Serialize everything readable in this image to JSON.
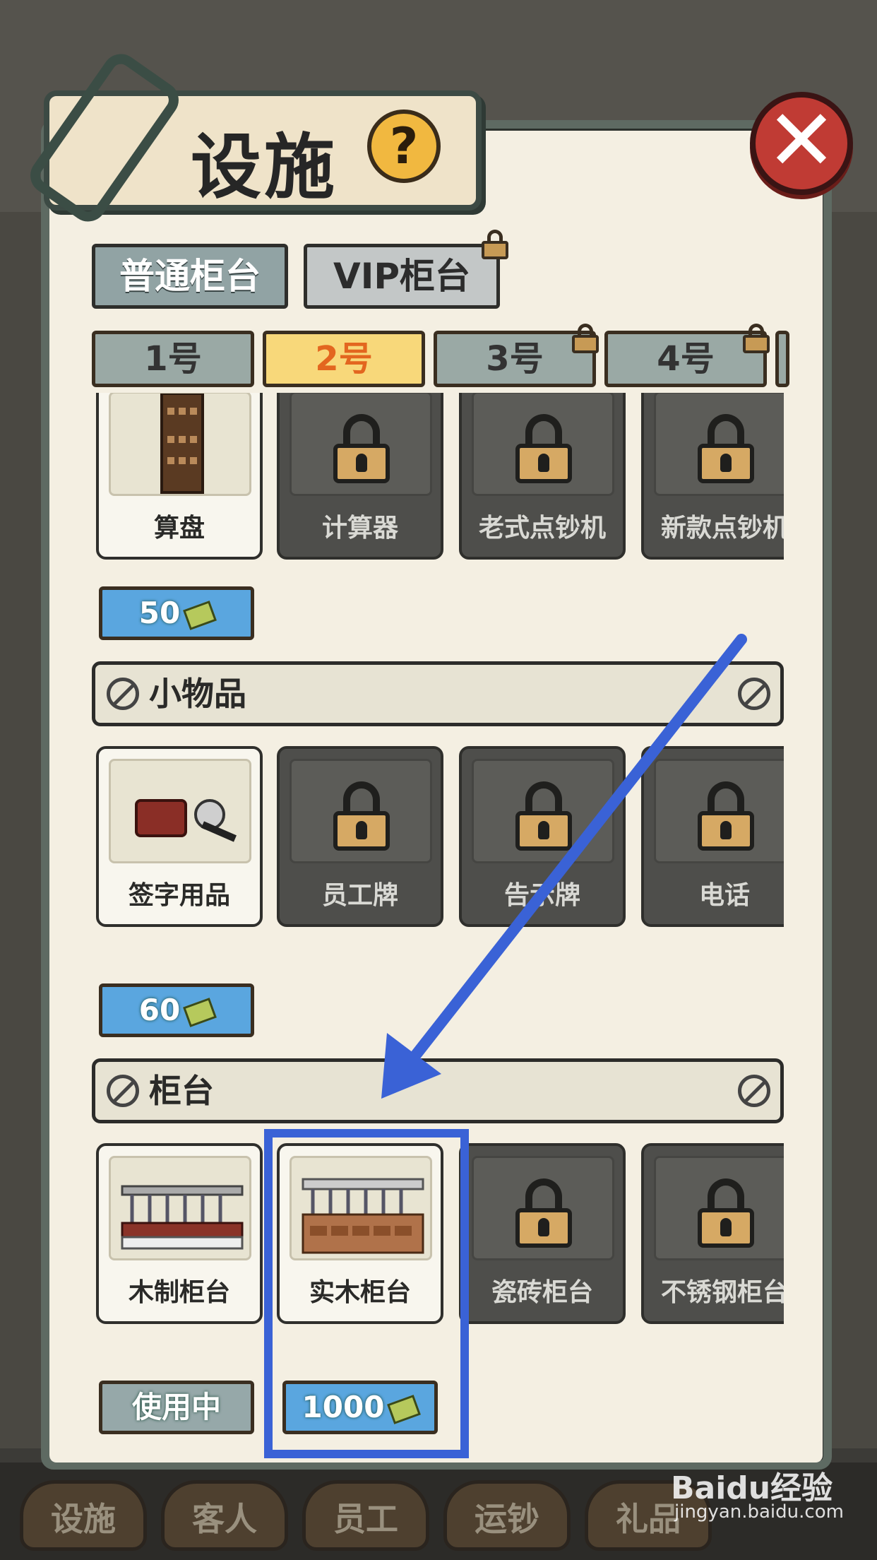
{
  "header": {
    "title": "设施",
    "help_symbol": "?",
    "close_symbol": "✕"
  },
  "counter_tabs": [
    {
      "label": "普通柜台",
      "locked": false
    },
    {
      "label": "VIP柜台",
      "locked": true
    }
  ],
  "number_tabs": [
    {
      "label": "1号",
      "active": false,
      "locked": false
    },
    {
      "label": "2号",
      "active": true,
      "locked": false
    },
    {
      "label": "3号",
      "active": false,
      "locked": true
    },
    {
      "label": "4号",
      "active": false,
      "locked": true
    }
  ],
  "sections": {
    "tools": {
      "items": [
        {
          "name": "算盘",
          "locked": false,
          "icon": "abacus-icon"
        },
        {
          "name": "计算器",
          "locked": true,
          "icon": "calculator-icon"
        },
        {
          "name": "老式点钞机",
          "locked": true,
          "icon": "old-money-counter-icon"
        },
        {
          "name": "新款点钞机",
          "locked": true,
          "icon": "new-money-counter-icon"
        }
      ],
      "price": "50"
    },
    "small_items": {
      "label": "小物品",
      "items": [
        {
          "name": "签字用品",
          "locked": false,
          "icon": "signing-kit-icon"
        },
        {
          "name": "员工牌",
          "locked": true,
          "icon": "badge-icon"
        },
        {
          "name": "告示牌",
          "locked": true,
          "icon": "notice-board-icon"
        },
        {
          "name": "电话",
          "locked": true,
          "icon": "phone-icon"
        }
      ],
      "price": "60"
    },
    "counters": {
      "label": "柜台",
      "items": [
        {
          "name": "木制柜台",
          "locked": false,
          "icon": "wooden-counter-icon"
        },
        {
          "name": "实木柜台",
          "locked": false,
          "icon": "solid-wood-counter-icon"
        },
        {
          "name": "瓷砖柜台",
          "locked": true,
          "icon": "tile-counter-icon"
        },
        {
          "name": "不锈钢柜台",
          "locked": true,
          "icon": "steel-counter-icon"
        }
      ],
      "status_in_use": "使用中",
      "price": "1000"
    }
  },
  "bottom_nav": [
    "设施",
    "客人",
    "员工",
    "运钞",
    "礼品"
  ],
  "watermark": {
    "brand": "Baidu经验",
    "url": "jingyan.baidu.com"
  },
  "colors": {
    "highlight": "#3a62d6",
    "active_tab": "#f8d87a",
    "close": "#c03b34"
  }
}
